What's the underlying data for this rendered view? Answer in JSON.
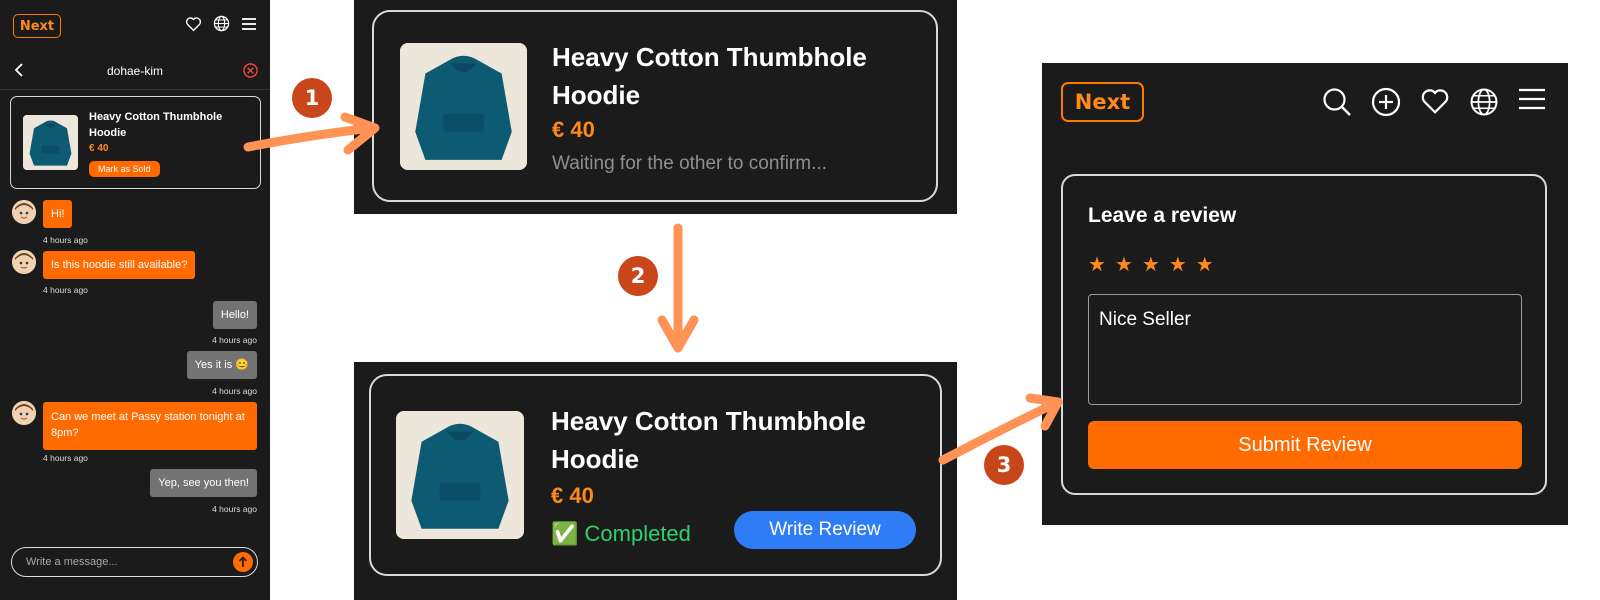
{
  "colors": {
    "accent": "#ff6b00",
    "panel_bg": "#1b1b1b",
    "blue": "#2f7df6",
    "step_badge": "#c9461a",
    "arrow": "#ff9255",
    "completed_text": "#2ed16b"
  },
  "app": {
    "logo": "Next"
  },
  "chat": {
    "username": "dohae-kim",
    "product": {
      "title": "Heavy Cotton Thumbhole Hoodie",
      "price": "€ 40",
      "mark_sold": "Mark as Sold"
    },
    "messages": [
      {
        "dir": "in",
        "text": "Hi!",
        "time": "4 hours ago"
      },
      {
        "dir": "in",
        "text": "Is this hoodie still available?",
        "time": "4 hours ago"
      },
      {
        "dir": "out",
        "text": "Hello!",
        "time": "4 hours ago"
      },
      {
        "dir": "out",
        "text": "Yes it is 😊",
        "time": "4 hours ago"
      },
      {
        "dir": "in",
        "text": "Can we meet at Passy station tonight at 8pm?",
        "time": "4 hours ago"
      },
      {
        "dir": "out",
        "text": "Yep, see you then!",
        "time": "4 hours ago"
      }
    ],
    "composer_placeholder": "Write a message..."
  },
  "pending": {
    "title": "Heavy Cotton Thumbhole Hoodie",
    "price": "€ 40",
    "status": "Waiting for the other to confirm..."
  },
  "completed": {
    "title": "Heavy Cotton Thumbhole Hoodie",
    "price": "€ 40",
    "status": "✅ Completed",
    "write_review": "Write Review"
  },
  "review": {
    "heading": "Leave a review",
    "rating": 5,
    "max_rating": 5,
    "text": "Nice Seller",
    "submit": "Submit Review"
  },
  "steps": [
    "1",
    "2",
    "3"
  ],
  "icons": {
    "chat_top": [
      "heart-icon",
      "globe-icon",
      "menu-icon"
    ],
    "review_top": [
      "search-icon",
      "add-circle-icon",
      "heart-icon",
      "globe-icon",
      "menu-icon"
    ]
  }
}
